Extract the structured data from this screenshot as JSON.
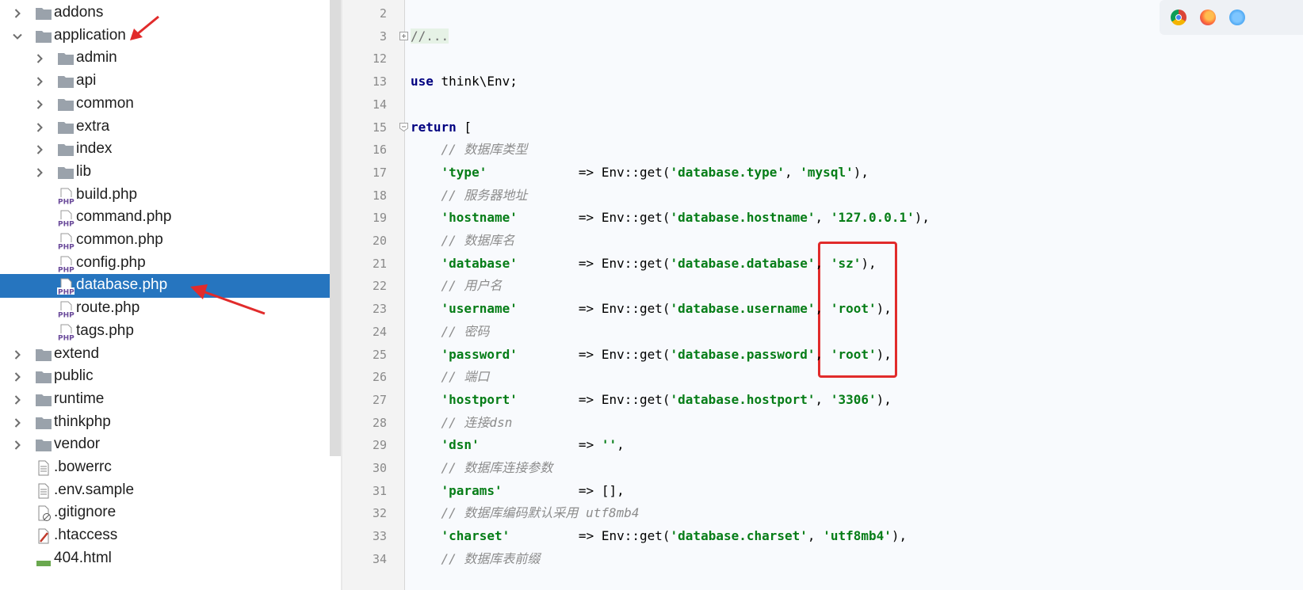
{
  "tree": {
    "items": [
      {
        "label": "addons",
        "type": "folder",
        "indent": 0,
        "expandable": true,
        "expanded": false
      },
      {
        "label": "application",
        "type": "folder",
        "indent": 0,
        "expandable": true,
        "expanded": true
      },
      {
        "label": "admin",
        "type": "folder",
        "indent": 1,
        "expandable": true,
        "expanded": false
      },
      {
        "label": "api",
        "type": "folder",
        "indent": 1,
        "expandable": true,
        "expanded": false
      },
      {
        "label": "common",
        "type": "folder",
        "indent": 1,
        "expandable": true,
        "expanded": false
      },
      {
        "label": "extra",
        "type": "folder",
        "indent": 1,
        "expandable": true,
        "expanded": false
      },
      {
        "label": "index",
        "type": "folder",
        "indent": 1,
        "expandable": true,
        "expanded": false
      },
      {
        "label": "lib",
        "type": "folder",
        "indent": 1,
        "expandable": true,
        "expanded": false
      },
      {
        "label": "build.php",
        "type": "php",
        "indent": 1,
        "expandable": false
      },
      {
        "label": "command.php",
        "type": "php",
        "indent": 1,
        "expandable": false
      },
      {
        "label": "common.php",
        "type": "php",
        "indent": 1,
        "expandable": false
      },
      {
        "label": "config.php",
        "type": "php",
        "indent": 1,
        "expandable": false
      },
      {
        "label": "database.php",
        "type": "php",
        "indent": 1,
        "expandable": false,
        "selected": true
      },
      {
        "label": "route.php",
        "type": "php",
        "indent": 1,
        "expandable": false
      },
      {
        "label": "tags.php",
        "type": "php",
        "indent": 1,
        "expandable": false
      },
      {
        "label": "extend",
        "type": "folder",
        "indent": 0,
        "expandable": true,
        "expanded": false
      },
      {
        "label": "public",
        "type": "folder",
        "indent": 0,
        "expandable": true,
        "expanded": false
      },
      {
        "label": "runtime",
        "type": "folder",
        "indent": 0,
        "expandable": true,
        "expanded": false
      },
      {
        "label": "thinkphp",
        "type": "folder",
        "indent": 0,
        "expandable": true,
        "expanded": false
      },
      {
        "label": "vendor",
        "type": "folder",
        "indent": 0,
        "expandable": true,
        "expanded": false
      },
      {
        "label": ".bowerrc",
        "type": "text",
        "indent": 0,
        "expandable": false
      },
      {
        "label": ".env.sample",
        "type": "text",
        "indent": 0,
        "expandable": false
      },
      {
        "label": ".gitignore",
        "type": "ignore",
        "indent": 0,
        "expandable": false
      },
      {
        "label": ".htaccess",
        "type": "htaccess",
        "indent": 0,
        "expandable": false
      },
      {
        "label": "404.html",
        "type": "html",
        "indent": 0,
        "expandable": false
      }
    ]
  },
  "editor": {
    "lines": [
      {
        "num": "2",
        "tokens": []
      },
      {
        "num": "3",
        "tokens": [
          {
            "t": "//...",
            "c": "fold"
          }
        ]
      },
      {
        "num": "12",
        "tokens": []
      },
      {
        "num": "13",
        "tokens": [
          {
            "t": "use",
            "c": "kw"
          },
          {
            "t": " think\\Env;",
            "c": "plain"
          }
        ]
      },
      {
        "num": "14",
        "tokens": []
      },
      {
        "num": "15",
        "tokens": [
          {
            "t": "return",
            "c": "kw"
          },
          {
            "t": " [",
            "c": "plain"
          }
        ]
      },
      {
        "num": "16",
        "tokens": [
          {
            "t": "    "
          },
          {
            "t": "// 数据库类型",
            "c": "cmt"
          }
        ]
      },
      {
        "num": "17",
        "tokens": [
          {
            "t": "    "
          },
          {
            "t": "'type'",
            "c": "str"
          },
          {
            "t": "            => Env::get(",
            "c": "plain"
          },
          {
            "t": "'database.type'",
            "c": "str"
          },
          {
            "t": ", ",
            "c": "plain"
          },
          {
            "t": "'mysql'",
            "c": "str"
          },
          {
            "t": "),",
            "c": "plain"
          }
        ]
      },
      {
        "num": "18",
        "tokens": [
          {
            "t": "    "
          },
          {
            "t": "// 服务器地址",
            "c": "cmt"
          }
        ]
      },
      {
        "num": "19",
        "tokens": [
          {
            "t": "    "
          },
          {
            "t": "'hostname'",
            "c": "str"
          },
          {
            "t": "        => Env::get(",
            "c": "plain"
          },
          {
            "t": "'database.hostname'",
            "c": "str"
          },
          {
            "t": ", ",
            "c": "plain"
          },
          {
            "t": "'127.0.0.1'",
            "c": "str"
          },
          {
            "t": "),",
            "c": "plain"
          }
        ]
      },
      {
        "num": "20",
        "tokens": [
          {
            "t": "    "
          },
          {
            "t": "// 数据库名",
            "c": "cmt"
          }
        ]
      },
      {
        "num": "21",
        "tokens": [
          {
            "t": "    "
          },
          {
            "t": "'database'",
            "c": "str"
          },
          {
            "t": "        => Env::get(",
            "c": "plain"
          },
          {
            "t": "'database.database'",
            "c": "str"
          },
          {
            "t": ", ",
            "c": "plain"
          },
          {
            "t": "'sz'",
            "c": "str"
          },
          {
            "t": "),",
            "c": "plain"
          }
        ]
      },
      {
        "num": "22",
        "tokens": [
          {
            "t": "    "
          },
          {
            "t": "// 用户名",
            "c": "cmt"
          }
        ]
      },
      {
        "num": "23",
        "tokens": [
          {
            "t": "    "
          },
          {
            "t": "'username'",
            "c": "str"
          },
          {
            "t": "        => Env::get(",
            "c": "plain"
          },
          {
            "t": "'database.username'",
            "c": "str"
          },
          {
            "t": ", ",
            "c": "plain"
          },
          {
            "t": "'root'",
            "c": "str"
          },
          {
            "t": "),",
            "c": "plain"
          }
        ]
      },
      {
        "num": "24",
        "tokens": [
          {
            "t": "    "
          },
          {
            "t": "// 密码",
            "c": "cmt"
          }
        ]
      },
      {
        "num": "25",
        "tokens": [
          {
            "t": "    "
          },
          {
            "t": "'password'",
            "c": "str"
          },
          {
            "t": "        => Env::get(",
            "c": "plain"
          },
          {
            "t": "'database.password'",
            "c": "str"
          },
          {
            "t": ", ",
            "c": "plain"
          },
          {
            "t": "'root'",
            "c": "str"
          },
          {
            "t": "),",
            "c": "plain"
          }
        ]
      },
      {
        "num": "26",
        "tokens": [
          {
            "t": "    "
          },
          {
            "t": "// 端口",
            "c": "cmt"
          }
        ]
      },
      {
        "num": "27",
        "tokens": [
          {
            "t": "    "
          },
          {
            "t": "'hostport'",
            "c": "str"
          },
          {
            "t": "        => Env::get(",
            "c": "plain"
          },
          {
            "t": "'database.hostport'",
            "c": "str"
          },
          {
            "t": ", ",
            "c": "plain"
          },
          {
            "t": "'3306'",
            "c": "str"
          },
          {
            "t": "),",
            "c": "plain"
          }
        ]
      },
      {
        "num": "28",
        "tokens": [
          {
            "t": "    "
          },
          {
            "t": "// 连接dsn",
            "c": "cmt"
          }
        ]
      },
      {
        "num": "29",
        "tokens": [
          {
            "t": "    "
          },
          {
            "t": "'dsn'",
            "c": "str"
          },
          {
            "t": "             => ",
            "c": "plain"
          },
          {
            "t": "''",
            "c": "str"
          },
          {
            "t": ",",
            "c": "plain"
          }
        ]
      },
      {
        "num": "30",
        "tokens": [
          {
            "t": "    "
          },
          {
            "t": "// 数据库连接参数",
            "c": "cmt"
          }
        ]
      },
      {
        "num": "31",
        "tokens": [
          {
            "t": "    "
          },
          {
            "t": "'params'",
            "c": "str"
          },
          {
            "t": "          => [],",
            "c": "plain"
          }
        ]
      },
      {
        "num": "32",
        "tokens": [
          {
            "t": "    "
          },
          {
            "t": "// 数据库编码默认采用 utf8mb4",
            "c": "cmt"
          }
        ]
      },
      {
        "num": "33",
        "tokens": [
          {
            "t": "    "
          },
          {
            "t": "'charset'",
            "c": "str"
          },
          {
            "t": "         => Env::get(",
            "c": "plain"
          },
          {
            "t": "'database.charset'",
            "c": "str"
          },
          {
            "t": ", ",
            "c": "plain"
          },
          {
            "t": "'utf8mb4'",
            "c": "str"
          },
          {
            "t": "),",
            "c": "plain"
          }
        ]
      },
      {
        "num": "34",
        "tokens": [
          {
            "t": "    "
          },
          {
            "t": "// 数据库表前缀",
            "c": "cmt"
          }
        ]
      }
    ]
  },
  "colors": {
    "selection": "#2675bf",
    "annotation_red": "#e12b2b",
    "string_green": "#067d17",
    "keyword_navy": "#000080",
    "comment_gray": "#8c8c8c"
  },
  "browser_icons": [
    "chrome-icon",
    "firefox-icon",
    "safari-icon"
  ]
}
